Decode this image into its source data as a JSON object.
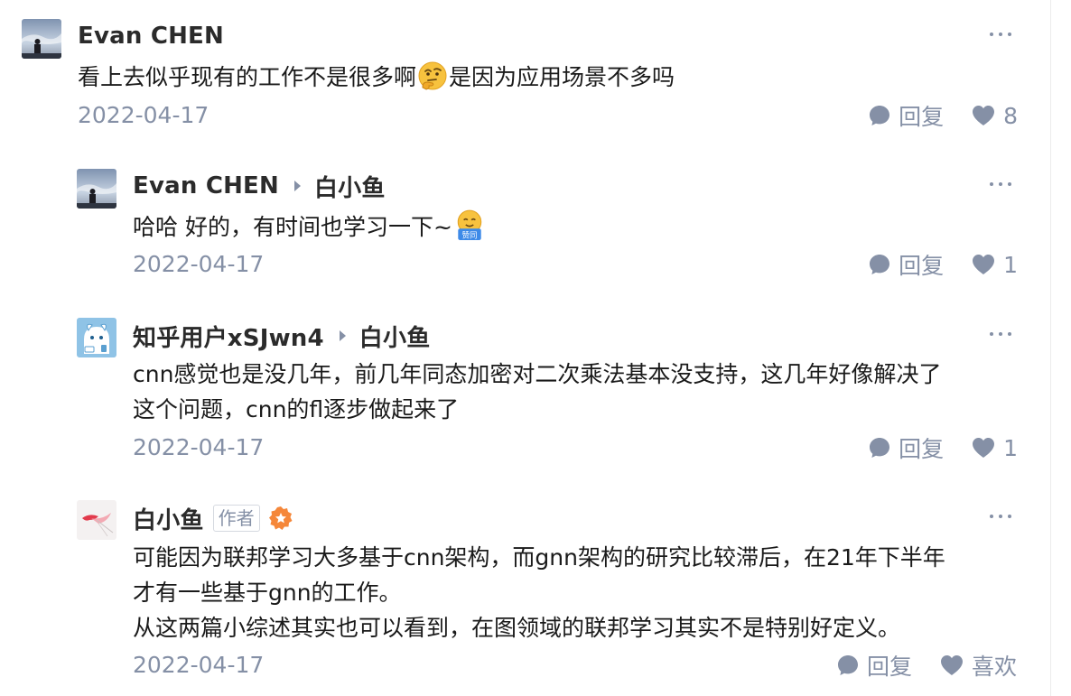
{
  "comments": [
    {
      "author": "Evan CHEN",
      "reply_to": null,
      "lines": [
        [
          "看上去似乎现有的工作不是很多啊",
          "是因为应用场景不多吗"
        ]
      ],
      "date": "2022-04-17",
      "reply_label": "回复",
      "like_value": "8"
    },
    {
      "author": "Evan CHEN",
      "reply_to": "白小鱼",
      "lines": [
        [
          "哈哈 好的，有时间也学习一下~"
        ]
      ],
      "date": "2022-04-17",
      "reply_label": "回复",
      "like_value": "1"
    },
    {
      "author": "知乎用户xSJwn4",
      "reply_to": "白小鱼",
      "lines": [
        "cnn感觉也是没几年，前几年同态加密对二次乘法基本没支持，这几年好像解决了",
        "这个问题，cnn的fl逐步做起来了"
      ],
      "date": "2022-04-17",
      "reply_label": "回复",
      "like_value": "1"
    },
    {
      "author": "白小鱼",
      "author_tag": "作者",
      "lines": [
        "可能因为联邦学习大多基于cnn架构，而gnn架构的研究比较滞后，在21年下半年",
        "才有一些基于gnn的工作。",
        "从这两篇小综述其实也可以看到，在图领域的联邦学习其实不是特别好定义。"
      ],
      "date": "2022-04-17",
      "reply_label": "回复",
      "like_value": "喜欢"
    }
  ],
  "icons": {
    "more": "more-dots-icon",
    "reply": "comment-bubble-icon",
    "like": "heart-icon",
    "thinking_emoji": "thinking-face-emoji",
    "agree_emoji": "agree-sticker-emoji",
    "badge": "creator-badge-icon"
  },
  "emoji_text": {
    "agree": "赞同"
  },
  "colors": {
    "meta_gray": "#8590a6",
    "text": "#1a1a1a",
    "badge_orange": "#f5873a"
  }
}
